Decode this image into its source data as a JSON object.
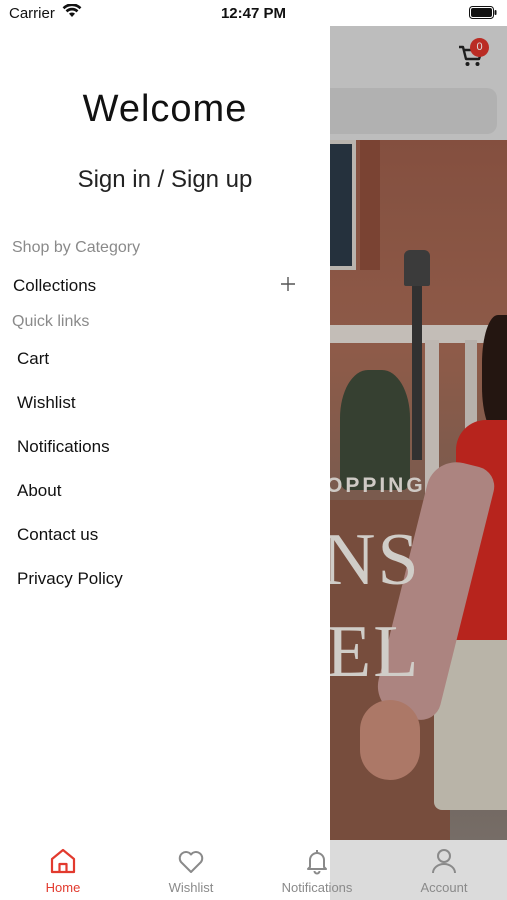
{
  "status_bar": {
    "carrier": "Carrier",
    "time": "12:47 PM",
    "icons": [
      "wifi-icon",
      "battery-icon"
    ]
  },
  "background_app": {
    "cart_badge": "0",
    "hero_text": [
      "OPPING",
      "NS",
      "EL"
    ]
  },
  "drawer": {
    "title": "Welcome",
    "sign_in": "Sign in / Sign up",
    "shop_by_category": "Shop by Category",
    "collections": "Collections",
    "quick_links_title": "Quick links",
    "quick_links": [
      "Cart",
      "Wishlist",
      "Notifications",
      "About",
      "Contact us",
      "Privacy Policy"
    ]
  },
  "tabbar": {
    "active_color": "#e23a2e",
    "tabs": [
      {
        "label": "Home",
        "icon": "home-icon",
        "active": true
      },
      {
        "label": "Wishlist",
        "icon": "heart-icon",
        "active": false
      },
      {
        "label": "Notifications",
        "icon": "bell-icon",
        "active": false
      },
      {
        "label": "Account",
        "icon": "user-icon",
        "active": false
      }
    ]
  }
}
